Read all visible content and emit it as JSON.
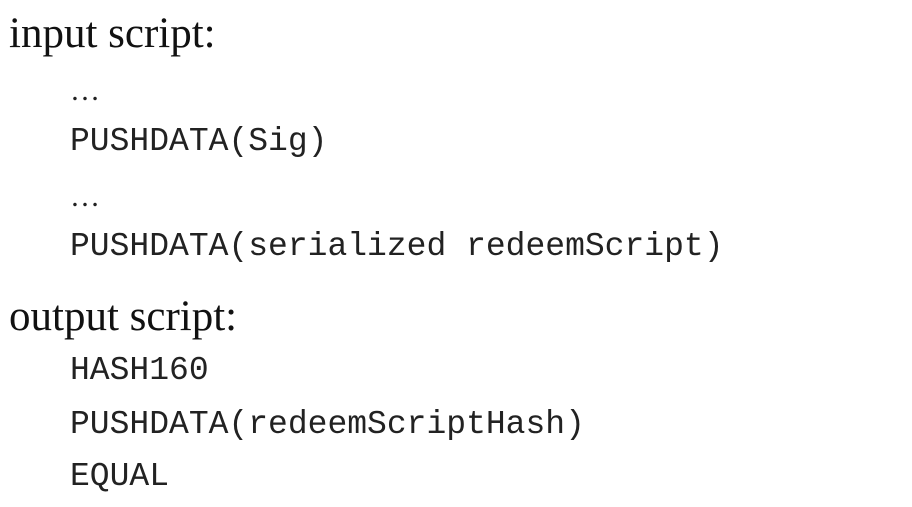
{
  "input_script": {
    "heading": "input script:",
    "lines": [
      "…",
      "PUSHDATA(Sig)",
      "…",
      "PUSHDATA(serialized redeemScript)"
    ]
  },
  "output_script": {
    "heading": "output script:",
    "lines": [
      "HASH160",
      "PUSHDATA(redeemScriptHash)",
      "EQUAL"
    ]
  },
  "colors": {
    "background": "#ffffff",
    "text": "#111111"
  }
}
